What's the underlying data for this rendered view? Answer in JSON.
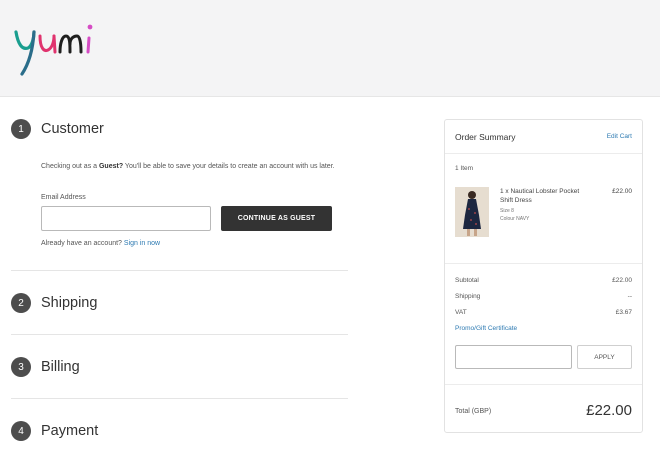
{
  "brand": {
    "logo_text": "Yumi"
  },
  "steps": [
    {
      "number": "1",
      "title": "Customer"
    },
    {
      "number": "2",
      "title": "Shipping"
    },
    {
      "number": "3",
      "title": "Billing"
    },
    {
      "number": "4",
      "title": "Payment"
    }
  ],
  "customer": {
    "intro_prefix": "Checking out as a ",
    "intro_bold": "Guest?",
    "intro_suffix": " You'll be able to save your details to create an account with us later.",
    "email_label": "Email Address",
    "email_value": "",
    "continue_label": "CONTINUE AS GUEST",
    "already_text": "Already have an account?",
    "sign_in_label": "Sign in now"
  },
  "summary": {
    "title": "Order Summary",
    "edit_cart_label": "Edit Cart",
    "items_count": "1 Item",
    "product": {
      "name": "1 x Nautical Lobster Pocket Shift Dress",
      "size": "Size 8",
      "colour": "Colour NAVY",
      "price": "£22.00"
    },
    "subtotal_label": "Subtotal",
    "subtotal_value": "£22.00",
    "shipping_label": "Shipping",
    "shipping_value": "--",
    "vat_label": "VAT",
    "vat_value": "£3.67",
    "promo_label": "Promo/Gift Certificate",
    "promo_value": "",
    "apply_label": "APPLY",
    "total_label": "Total (GBP)",
    "total_value": "£22.00"
  },
  "colors": {
    "step_badge": "#4d4d4d",
    "primary_button": "#333333",
    "link": "#2d7ab2",
    "header_bg": "#f4f4f5"
  },
  "icons": {
    "product_thumbnail": "dress-image"
  }
}
